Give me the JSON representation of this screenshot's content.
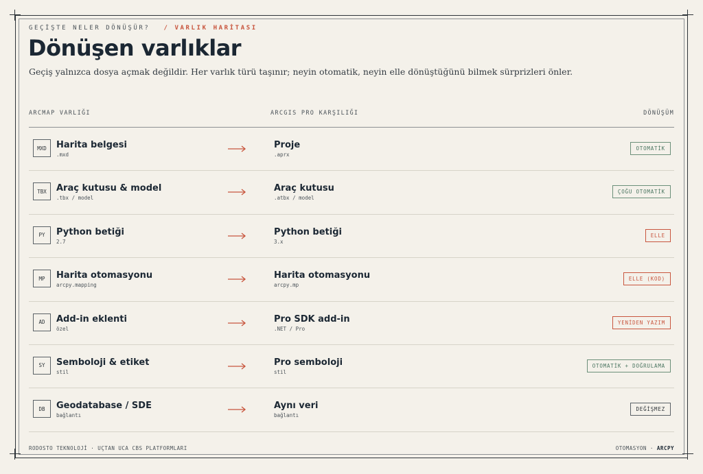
{
  "header": {
    "eyebrow": "GEÇİŞTE NELER DÖNÜŞÜR?",
    "eyebrow_accent": "/ VARLIK HARİTASI",
    "title": "Dönüşen varlıklar",
    "subtitle": "Geçiş yalnızca dosya açmak değildir. Her varlık türü taşınır; neyin otomatik, neyin elle dönüştüğünü bilmek sürprizleri önler."
  },
  "columns": {
    "source": "ARCMAP VARLIĞI",
    "target": "ARCGIS PRO KARŞILIĞI",
    "conversion": "DÖNÜŞÜM"
  },
  "rows": [
    {
      "code": "MXD",
      "source_name": "Harita belgesi",
      "source_sub": ".mxd",
      "target_name": "Proje",
      "target_sub": ".aprx",
      "badge": "OTOMATİK",
      "badge_kind": "green"
    },
    {
      "code": "TBX",
      "source_name": "Araç kutusu & model",
      "source_sub": ".tbx / model",
      "target_name": "Araç kutusu",
      "target_sub": ".atbx / model",
      "badge": "ÇOĞU OTOMATİK",
      "badge_kind": "green"
    },
    {
      "code": "PY",
      "source_name": "Python betiği",
      "source_sub": "2.7",
      "target_name": "Python betiği",
      "target_sub": "3.x",
      "badge": "ELLE",
      "badge_kind": "red"
    },
    {
      "code": "MP",
      "source_name": "Harita otomasyonu",
      "source_sub": "arcpy.mapping",
      "target_name": "Harita otomasyonu",
      "target_sub": "arcpy.mp",
      "badge": "ELLE (KOD)",
      "badge_kind": "red"
    },
    {
      "code": "AD",
      "source_name": "Add-in eklenti",
      "source_sub": "özel",
      "target_name": "Pro SDK add-in",
      "target_sub": ".NET / Pro",
      "badge": "YENİDEN YAZIM",
      "badge_kind": "red"
    },
    {
      "code": "SY",
      "source_name": "Semboloji & etiket",
      "source_sub": "stil",
      "target_name": "Pro semboloji",
      "target_sub": "stil",
      "badge": "OTOMATİK + DOĞRULAMA",
      "badge_kind": "green"
    },
    {
      "code": "DB",
      "source_name": "Geodatabase / SDE",
      "source_sub": "bağlantı",
      "target_name": "Aynı veri",
      "target_sub": "bağlantı",
      "badge": "DEĞİŞMEZ",
      "badge_kind": "dark"
    }
  ],
  "footer": {
    "left": "RODOSTO TEKNOLOJİ · UÇTAN UCA CBS PLATFORMLARI",
    "right_prefix": "OTOMASYON ·",
    "right_bold": "ARCPY"
  },
  "colors": {
    "accent": "#c8553d",
    "green": "#4a7560",
    "ink": "#1b2733",
    "background": "#f4f1ea"
  },
  "icons": {
    "arrow": "right-arrow-icon"
  }
}
